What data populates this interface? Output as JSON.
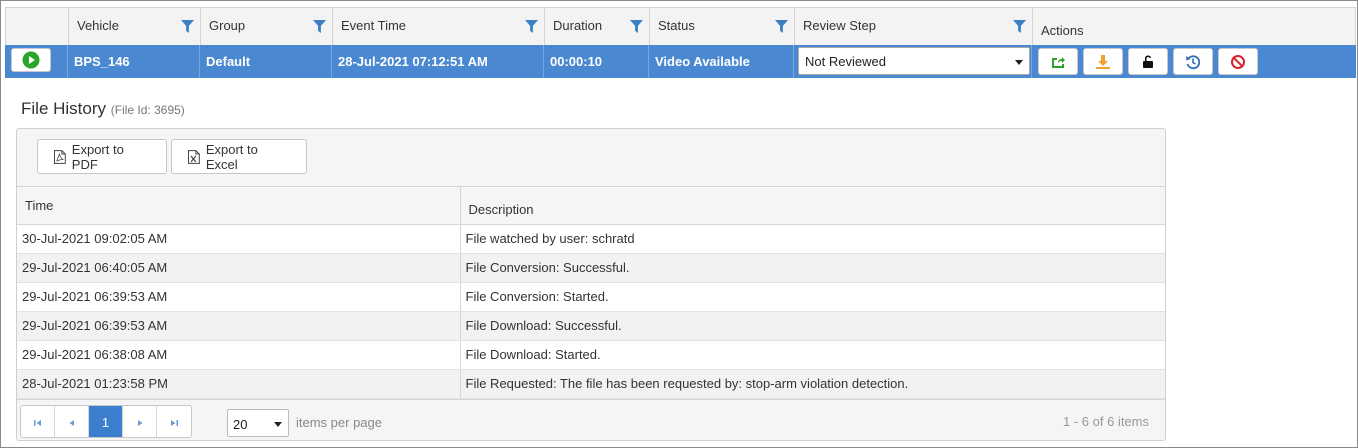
{
  "grid": {
    "columns": [
      {
        "label": "",
        "filter": false
      },
      {
        "label": "Vehicle",
        "filter": true
      },
      {
        "label": "Group",
        "filter": true
      },
      {
        "label": "Event Time",
        "filter": true
      },
      {
        "label": "Duration",
        "filter": true
      },
      {
        "label": "Status",
        "filter": true
      },
      {
        "label": "Review Step",
        "filter": true
      },
      {
        "label": "Actions",
        "filter": false
      }
    ],
    "row": {
      "vehicle": "BPS_146",
      "group": "Default",
      "event_time": "28-Jul-2021 07:12:51 AM",
      "duration": "00:00:10",
      "status": "Video Available",
      "review_step": "Not Reviewed"
    },
    "action_icons": [
      "share-icon",
      "download-icon",
      "unlock-icon",
      "history-icon",
      "block-icon"
    ],
    "colors": {
      "row_selected": "#4a89d1",
      "filter_icon": "#3b7fc4",
      "play": "#2aa52a",
      "share": "#2aa52a",
      "download": "#f0a030",
      "history": "#2f6fb5",
      "block": "#d9232e"
    }
  },
  "file_history": {
    "title": "File History",
    "file_id": "(File Id: 3695)",
    "export_pdf": "Export to PDF",
    "export_excel": "Export to Excel",
    "columns": [
      "Time",
      "Description"
    ],
    "rows": [
      {
        "time": "30-Jul-2021 09:02:05 AM",
        "description": "File watched by user: schratd"
      },
      {
        "time": "29-Jul-2021 06:40:05 AM",
        "description": "File Conversion: Successful."
      },
      {
        "time": "29-Jul-2021 06:39:53 AM",
        "description": "File Conversion: Started."
      },
      {
        "time": "29-Jul-2021 06:39:53 AM",
        "description": "File Download: Successful."
      },
      {
        "time": "29-Jul-2021 06:38:08 AM",
        "description": "File Download: Started."
      },
      {
        "time": "28-Jul-2021 01:23:58 PM",
        "description": "File Requested: The file has been requested by: stop-arm violation detection."
      }
    ],
    "pager": {
      "current_page": "1",
      "items_per_page": "20",
      "items_per_page_label": "items per page",
      "info": "1 - 6 of 6 items"
    }
  }
}
